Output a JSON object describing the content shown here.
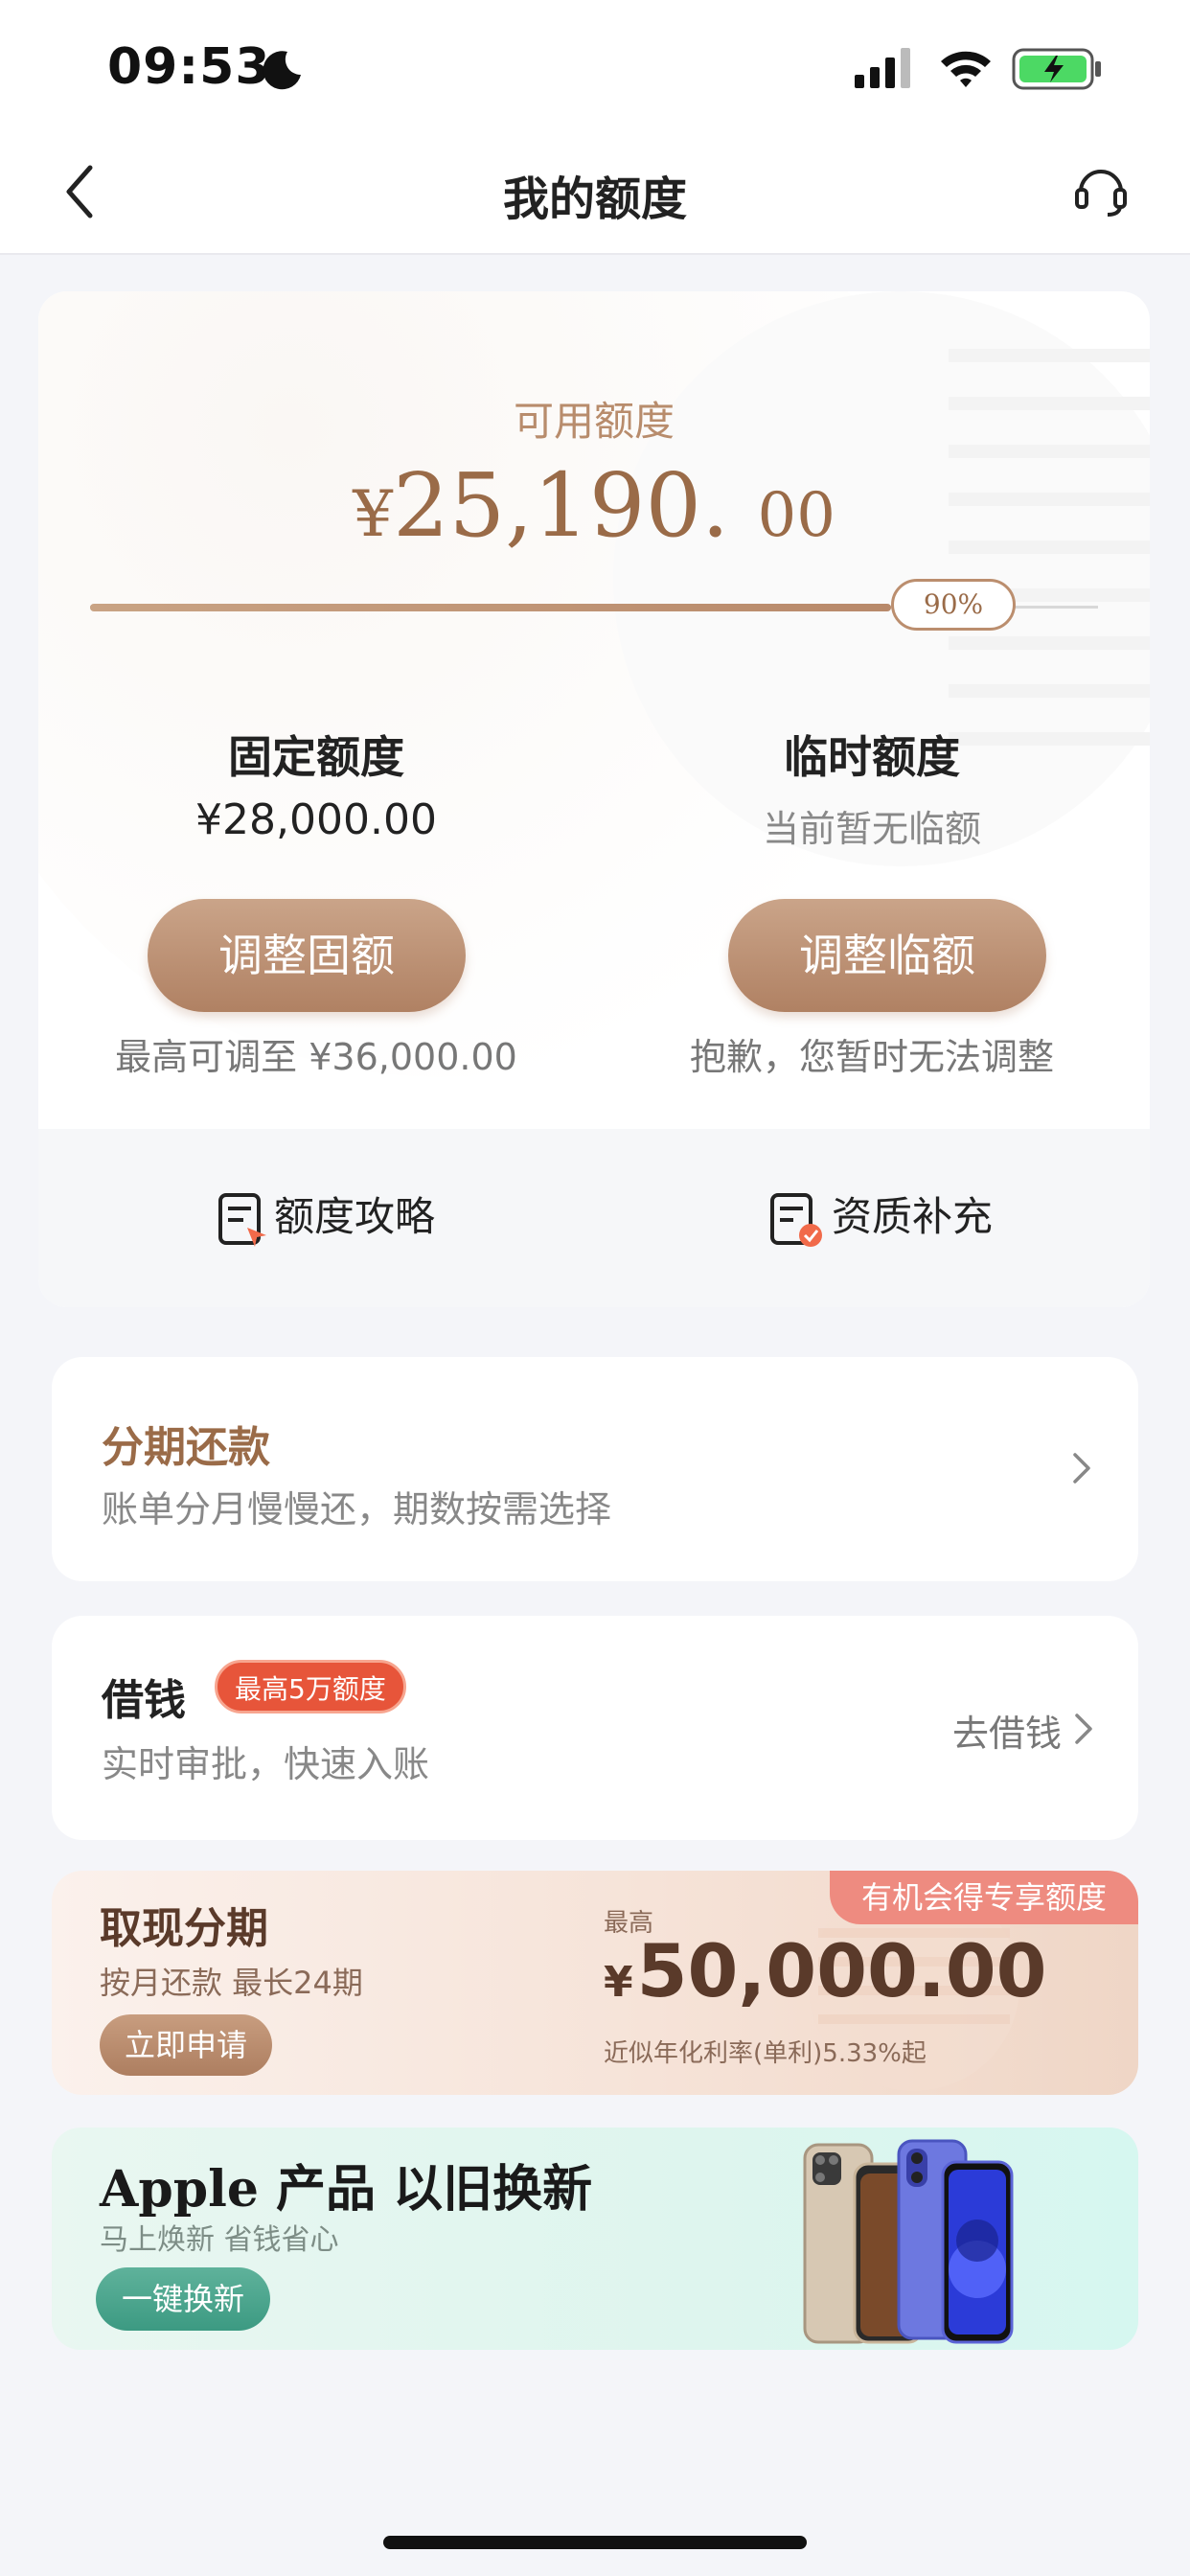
{
  "status_bar": {
    "time": "09:53"
  },
  "nav": {
    "title": "我的额度"
  },
  "credit": {
    "available_label": "可用额度",
    "available_yen": "¥",
    "available_integer": "25,190.",
    "available_cents": "00",
    "progress_percent": 90,
    "progress_label": "90%",
    "fixed": {
      "title": "固定额度",
      "value": "¥28,000.00",
      "button": "调整固额",
      "note": "最高可调至 ¥36,000.00"
    },
    "temp": {
      "title": "临时额度",
      "value": "当前暂无临额",
      "button": "调整临额",
      "note": "抱歉，您暂时无法调整"
    },
    "footer": {
      "strategy_label": "额度攻略",
      "supplement_label": "资质补充"
    }
  },
  "installment": {
    "title": "分期还款",
    "subtitle": "账单分月慢慢还，期数按需选择"
  },
  "borrow": {
    "title": "借钱",
    "badge": "最高5万额度",
    "subtitle": "实时审批，快速入账",
    "action": "去借钱"
  },
  "cash": {
    "title": "取现分期",
    "subtitle": "按月还款 最长24期",
    "button": "立即申请",
    "max_label": "最高",
    "yen": "¥",
    "amount": "50,000.00",
    "rate": "近似年化利率(单利)5.33%起",
    "tag": "有机会得专享额度"
  },
  "apple": {
    "title": "Apple 产品 以旧换新",
    "subtitle": "马上焕新 省钱省心",
    "button": "一键换新"
  },
  "colors": {
    "accent_brown": "#b08163",
    "badge_red": "#e7553a",
    "tag_pink": "#ee8b80",
    "apple_green": "#3c9a82"
  }
}
